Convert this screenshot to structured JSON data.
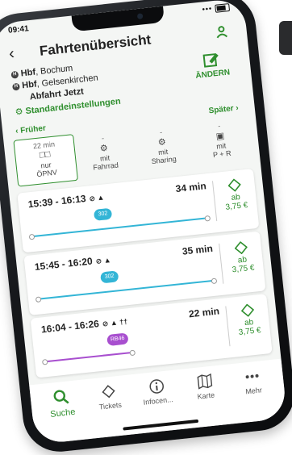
{
  "status": {
    "time": "09:41",
    "signal": "•••"
  },
  "header": {
    "title": "Fahrtenübersicht",
    "back": "‹"
  },
  "route": {
    "from_prefix": "Hbf",
    "from_suffix": ", Bochum",
    "to_prefix": "Hbf",
    "to_suffix": ", Gelsenkirchen",
    "departure": "Abfahrt Jetzt",
    "settings": "Standardeinstellungen",
    "edit_label": "ÄNDERN"
  },
  "nav": {
    "earlier": "‹ Früher",
    "later": "Später ›"
  },
  "modes": [
    {
      "dur": "22 min",
      "icon": "□□",
      "line1": "nur",
      "line2": "ÖPNV",
      "active": true
    },
    {
      "dur": "-",
      "icon": "⚙",
      "line1": "mit",
      "line2": "Fahrrad",
      "active": false
    },
    {
      "dur": "-",
      "icon": "⚙",
      "line1": "mit",
      "line2": "Sharing",
      "active": false
    },
    {
      "dur": "-",
      "icon": "▣",
      "line1": "mit",
      "line2": "P + R",
      "active": false
    }
  ],
  "connections": [
    {
      "times": "15:39 - 16:13",
      "duration": "34 min",
      "line": "302",
      "line_color": "#33b5d6",
      "track_color": "#33b5d6",
      "price_prefix": "ab",
      "price": "3,75 €",
      "icons": "⊘ ▲"
    },
    {
      "times": "15:45 - 16:20",
      "duration": "35 min",
      "line": "302",
      "line_color": "#33b5d6",
      "track_color": "#33b5d6",
      "price_prefix": "ab",
      "price": "3,75 €",
      "icons": "⊘ ▲"
    },
    {
      "times": "16:04 - 16:26",
      "duration": "22 min",
      "line": "RB46",
      "line_color": "#a84fcf",
      "track_color": "#a84fcf",
      "price_prefix": "ab",
      "price": "3,75 €",
      "icons": "⊘ ▲ ††"
    }
  ],
  "tabs": [
    {
      "label": "Suche",
      "icon": "search-icon",
      "active": true
    },
    {
      "label": "Tickets",
      "icon": "ticket-icon",
      "active": false
    },
    {
      "label": "Infocen...",
      "icon": "info-icon",
      "active": false
    },
    {
      "label": "Karte",
      "icon": "map-icon",
      "active": false
    },
    {
      "label": "Mehr",
      "icon": "more-icon",
      "active": false
    }
  ],
  "colors": {
    "accent": "#2f8f2e"
  }
}
